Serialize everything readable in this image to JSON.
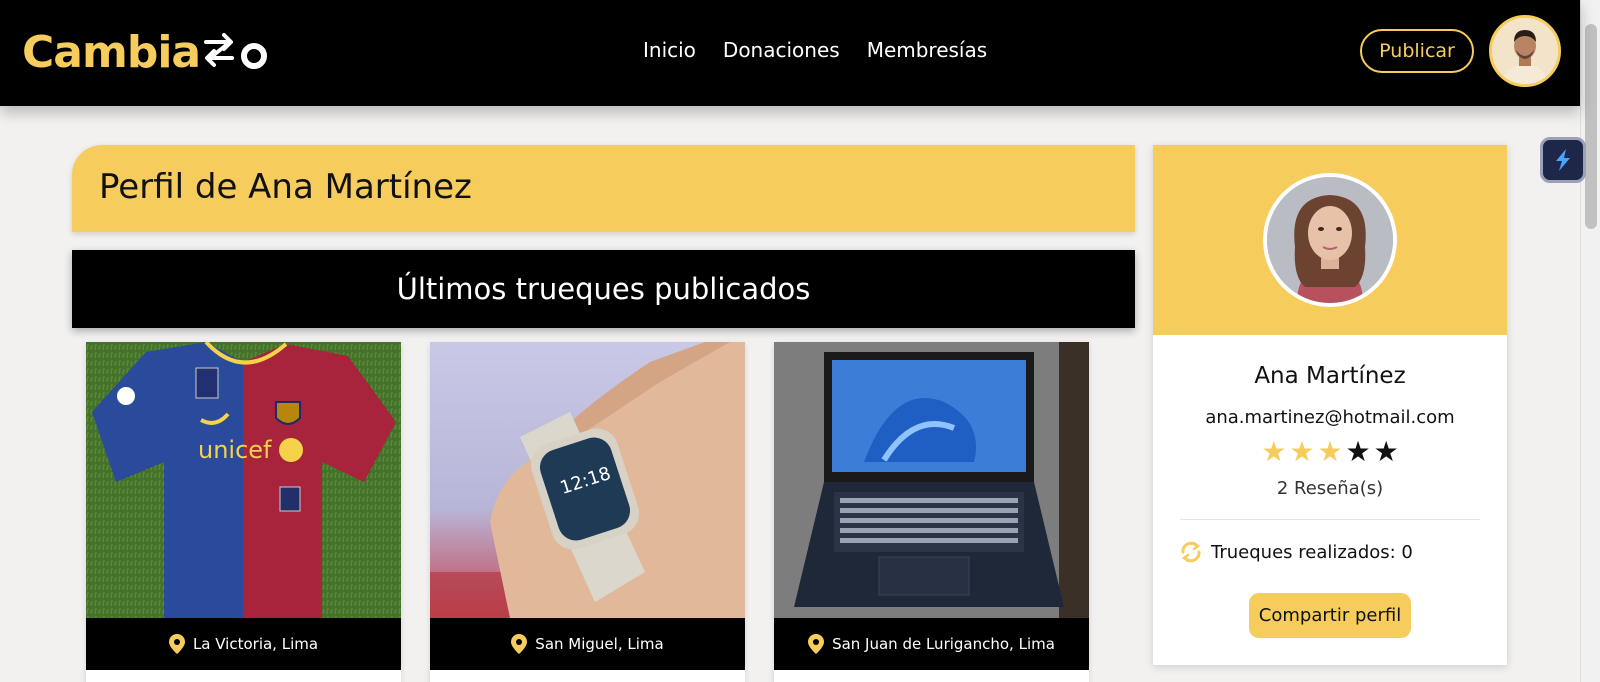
{
  "brand": {
    "name": "Cambia",
    "accent": "#f6cd5c"
  },
  "nav": {
    "items": [
      "Inicio",
      "Donaciones",
      "Membresías"
    ]
  },
  "header": {
    "publish_label": "Publicar"
  },
  "profile": {
    "title": "Perfil de Ana Martínez",
    "section_title": "Últimos trueques publicados"
  },
  "cards": [
    {
      "location": "La Victoria, Lima",
      "image": "barcelona-jersey"
    },
    {
      "location": "San Miguel, Lima",
      "image": "smartwatch-on-wrist"
    },
    {
      "location": "San Juan de Lurigancho, Lima",
      "image": "laptop-on-chair"
    }
  ],
  "side": {
    "name": "Ana Martínez",
    "email": "ana.martinez@hotmail.com",
    "rating": 3,
    "rating_max": 5,
    "reviews": "2 Reseña(s)",
    "trades": "Trueques realizados: 0",
    "share_label": "Compartir perfil"
  }
}
